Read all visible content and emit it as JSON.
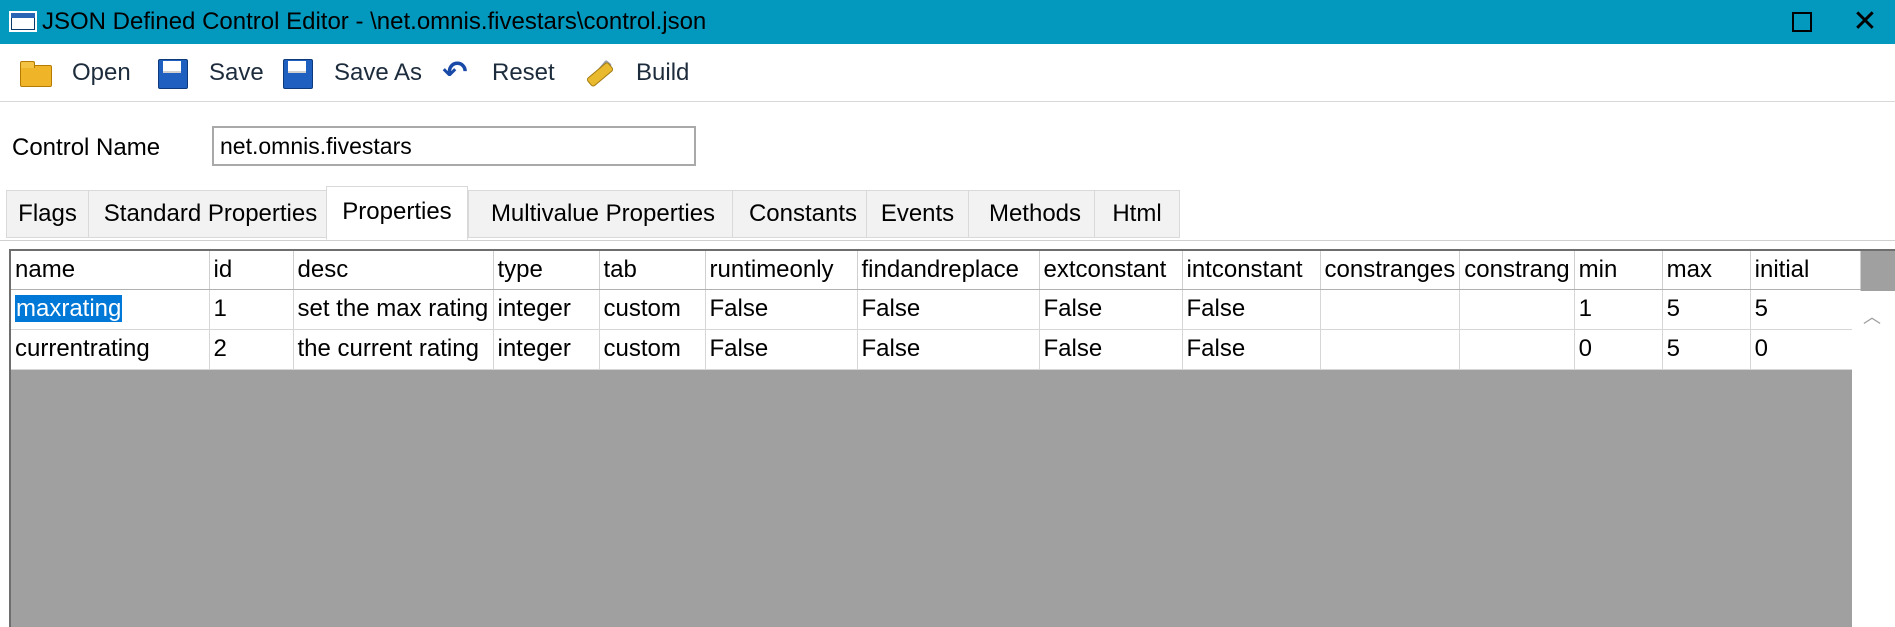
{
  "window": {
    "title": "JSON Defined Control Editor - \\net.omnis.fivestars\\control.json",
    "maximize_icon": "maximize-icon",
    "close_glyph": "✕"
  },
  "toolbar": {
    "open_label": "Open",
    "save_label": "Save",
    "save_as_label": "Save As",
    "reset_label": "Reset",
    "build_label": "Build",
    "reset_glyph": "↶"
  },
  "control_name": {
    "label": "Control Name",
    "value": "net.omnis.fivestars"
  },
  "tabs": [
    {
      "label": "Flags"
    },
    {
      "label": "Standard Properties"
    },
    {
      "label": "Properties"
    },
    {
      "label": "Multivalue Properties"
    },
    {
      "label": "Constants"
    },
    {
      "label": "Events"
    },
    {
      "label": "Methods"
    },
    {
      "label": "Html"
    }
  ],
  "active_tab": "Properties",
  "grid": {
    "columns": [
      "name",
      "id",
      "desc",
      "type",
      "tab",
      "runtimeonly",
      "findandreplace",
      "extconstant",
      "intconstant",
      "constranges",
      "constrang",
      "min",
      "max",
      "initial"
    ],
    "rows": [
      [
        "maxrating",
        "1",
        "set the max rating",
        "integer",
        "custom",
        "False",
        "False",
        "False",
        "False",
        "",
        "",
        "1",
        "5",
        "5"
      ],
      [
        "currentrating",
        "2",
        "the current rating",
        "integer",
        "custom",
        "False",
        "False",
        "False",
        "False",
        "",
        "",
        "0",
        "5",
        "0"
      ]
    ],
    "selected_cell": "maxrating",
    "scroll_up_glyph": "︿"
  },
  "colors": {
    "titlebar": "#0399bf",
    "selection": "#0078d7",
    "grid_background": "#a0a0a0"
  }
}
